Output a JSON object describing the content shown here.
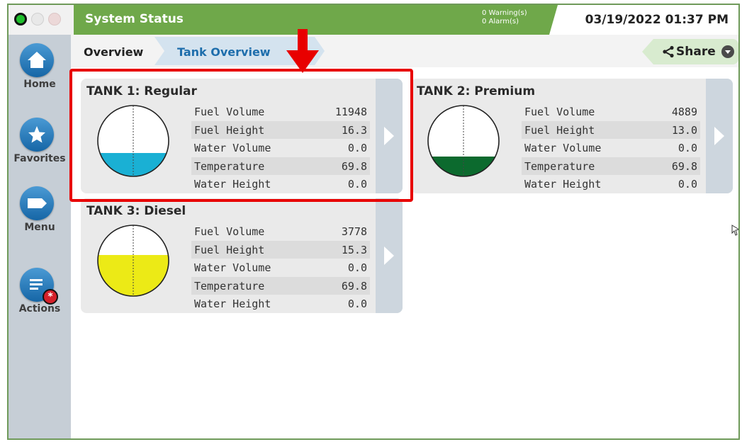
{
  "header": {
    "title": "System Status",
    "warnings": "0 Warning(s)",
    "alarms": "0 Alarm(s)",
    "datetime": "03/19/2022 01:37 PM"
  },
  "sidebar": {
    "items": [
      {
        "label": "Home",
        "icon": "home-icon"
      },
      {
        "label": "Favorites",
        "icon": "star-icon"
      },
      {
        "label": "Menu",
        "icon": "menu-icon"
      },
      {
        "label": "Actions",
        "icon": "actions-icon",
        "badge": "*"
      }
    ]
  },
  "breadcrumb": {
    "items": [
      "Overview",
      "Tank Overview"
    ],
    "share_label": "Share"
  },
  "metric_labels": [
    "Fuel Volume",
    "Fuel Height",
    "Water Volume",
    "Temperature",
    "Water Height"
  ],
  "tanks": [
    {
      "title": "TANK 1: Regular",
      "fill_fraction": 0.33,
      "fill_color": "#1ab0d4",
      "values": [
        "11948",
        "16.3",
        "0.0",
        "69.8",
        "0.0"
      ]
    },
    {
      "title": "TANK 2: Premium",
      "fill_fraction": 0.28,
      "fill_color": "#0c6a2e",
      "values": [
        "4889",
        "13.0",
        "0.0",
        "69.8",
        "0.0"
      ]
    },
    {
      "title": "TANK 3: Diesel",
      "fill_fraction": 0.58,
      "fill_color": "#ecea16",
      "values": [
        "3778",
        "15.3",
        "0.0",
        "69.8",
        "0.0"
      ]
    }
  ],
  "colors": {
    "brand_green": "#6fa84a",
    "highlight_red": "#e80000",
    "nav_blue": "#1666a6"
  }
}
